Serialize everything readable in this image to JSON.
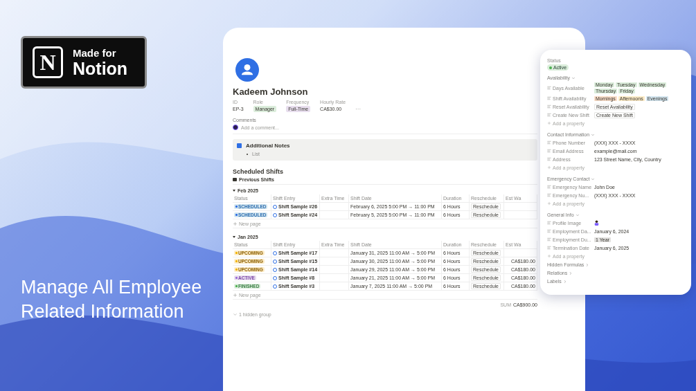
{
  "badge": {
    "logo": "N",
    "line1": "Made for",
    "line2": "Notion"
  },
  "headline": "Manage All Employee Related Information",
  "page": {
    "title": "Kadeem Johnson",
    "properties": [
      {
        "label": "ID",
        "value": "EP-3",
        "kind": "text"
      },
      {
        "label": "Role",
        "value": "Manager",
        "kind": "tag",
        "color": "#dbeddb"
      },
      {
        "label": "Frequency",
        "value": "Full-Time",
        "kind": "tag",
        "color": "#e8deee"
      },
      {
        "label": "Hourly Rate",
        "value": "CA$30.00",
        "kind": "text"
      }
    ],
    "more": "···",
    "comments_label": "Comments",
    "comment_placeholder": "Add a comment...",
    "notes": {
      "title": "Additional Notes",
      "items": [
        "List"
      ]
    },
    "section_title": "Scheduled Shifts",
    "view": "Previous Shifts",
    "groups": [
      {
        "name": "Feb 2025",
        "expanded": true,
        "new_page": "New page",
        "columns": [
          "Status",
          "Shift Entry",
          "Extra Time",
          "Shift Date",
          "Duration",
          "Reschedule",
          "Est Wa"
        ],
        "rows": [
          {
            "status": "SCHEDULED",
            "kind": "scheduled",
            "entry": "Shift Sample #26",
            "date": "February 6, 2025 5:00 PM → 11:00 PM",
            "duration": "6 Hours",
            "action": "Reschedule"
          },
          {
            "status": "SCHEDULED",
            "kind": "scheduled",
            "entry": "Shift Sample #24",
            "date": "February 5, 2025 5:00 PM → 11:00 PM",
            "duration": "6 Hours",
            "action": "Reschedule"
          }
        ]
      },
      {
        "name": "Jan 2025",
        "expanded": true,
        "new_page": "New page",
        "sum_label": "SUM",
        "sum": "CA$900.00",
        "columns": [
          "Status",
          "Shift Entry",
          "Extra Time",
          "Shift Date",
          "Duration",
          "Reschedule",
          "Est Wa"
        ],
        "rows": [
          {
            "status": "UPCOMING",
            "kind": "upcoming",
            "entry": "Shift Sample #17",
            "date": "January 31, 2025 11:00 AM → 5:00 PM",
            "duration": "6 Hours",
            "action": "Reschedule"
          },
          {
            "status": "UPCOMING",
            "kind": "upcoming",
            "entry": "Shift Sample #15",
            "date": "January 30, 2025 11:00 AM → 5:00 PM",
            "duration": "6 Hours",
            "action": "Reschedule",
            "wage": "CA$180.00"
          },
          {
            "status": "UPCOMING",
            "kind": "upcoming",
            "entry": "Shift Sample #14",
            "date": "January 29, 2025 11:00 AM → 5:00 PM",
            "duration": "6 Hours",
            "action": "Reschedule",
            "wage": "CA$180.00"
          },
          {
            "status": "ACTIVE",
            "kind": "active",
            "entry": "Shift Sample #8",
            "date": "January 21, 2025 11:00 AM → 5:00 PM",
            "duration": "6 Hours",
            "action": "Reschedule",
            "wage": "CA$180.00"
          },
          {
            "status": "FINISHED",
            "kind": "finished",
            "entry": "Shift Sample #3",
            "date": "January 7, 2025 11:00 AM → 5:00 PM",
            "duration": "6 Hours",
            "action": "Reschedule",
            "wage": "CA$180.00"
          }
        ]
      }
    ],
    "hidden_groups": "1 hidden group"
  },
  "panel": {
    "status_label": "Status",
    "status": "Active",
    "sections": [
      {
        "title": "Availability",
        "expanded": true,
        "add": "Add a property",
        "rows": [
          {
            "label": "Days Available",
            "kind": "tags",
            "tags": [
              {
                "text": "Monday",
                "color": "#dbeddb"
              },
              {
                "text": "Tuesday",
                "color": "#dbeddb"
              },
              {
                "text": "Wednesday",
                "color": "#dbeddb"
              },
              {
                "text": "Thursday",
                "color": "#dbeddb"
              },
              {
                "text": "Friday",
                "color": "#dbeddb"
              }
            ]
          },
          {
            "label": "Shift Availability",
            "kind": "tags",
            "tags": [
              {
                "text": "Mornings",
                "color": "#fadec9"
              },
              {
                "text": "Afternoons",
                "color": "#fdecc8"
              },
              {
                "text": "Evenings",
                "color": "#d3e5ef"
              }
            ]
          },
          {
            "label": "Reset Availability",
            "kind": "button",
            "value": "Reset Availability"
          },
          {
            "label": "Create New Shift",
            "kind": "button",
            "value": "Create New Shift"
          }
        ]
      },
      {
        "title": "Contact Information",
        "expanded": true,
        "add": "Add a property",
        "rows": [
          {
            "label": "Phone Number",
            "kind": "text",
            "value": "(XXX) XXX - XXXX"
          },
          {
            "label": "Email Address",
            "kind": "text",
            "value": "example@mail.com"
          },
          {
            "label": "Address",
            "kind": "text",
            "value": "123 Street Name, City, Country"
          }
        ]
      },
      {
        "title": "Emergency Contact",
        "expanded": true,
        "add": "Add a property",
        "rows": [
          {
            "label": "Emergency Name",
            "kind": "text",
            "value": "John Doe"
          },
          {
            "label": "Emergency Nu...",
            "kind": "text",
            "value": "(XXX) XXX - XXXX"
          }
        ]
      },
      {
        "title": "General Info",
        "expanded": true,
        "add": "Add a property",
        "rows": [
          {
            "label": "Profile Image",
            "kind": "image"
          },
          {
            "label": "Employment Da...",
            "kind": "text",
            "value": "January 6, 2024"
          },
          {
            "label": "Employment Du...",
            "kind": "tags",
            "tags": [
              {
                "text": "1 Year",
                "color": "#e3e2e0"
              }
            ]
          },
          {
            "label": "Termination Date",
            "kind": "text",
            "value": "January 6, 2025"
          }
        ]
      },
      {
        "title": "Hidden Formulas",
        "expanded": false
      },
      {
        "title": "Relations",
        "expanded": false
      },
      {
        "title": "Labels",
        "expanded": false
      }
    ]
  }
}
